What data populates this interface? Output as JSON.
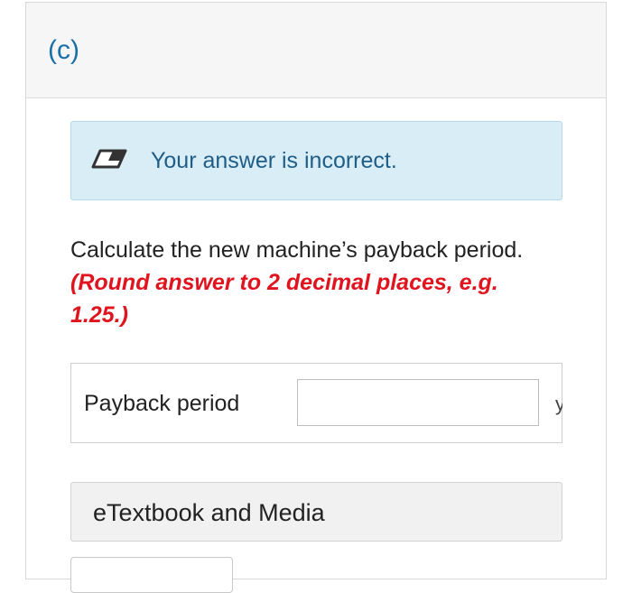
{
  "part": {
    "label": "(c)"
  },
  "feedback": {
    "icon": "eraser-icon",
    "text": "Your answer is incorrect.",
    "background_color": "#d9edf7",
    "text_color": "#1f5d87"
  },
  "question": {
    "text": "Calculate the new machine’s payback period.",
    "hint": "(Round answer to 2 decimal places, e.g. 1.25.)",
    "hint_color": "#e0141e"
  },
  "answer": {
    "label": "Payback period",
    "value": "",
    "unit": "y"
  },
  "etextbook": {
    "label": "eTextbook and Media"
  }
}
